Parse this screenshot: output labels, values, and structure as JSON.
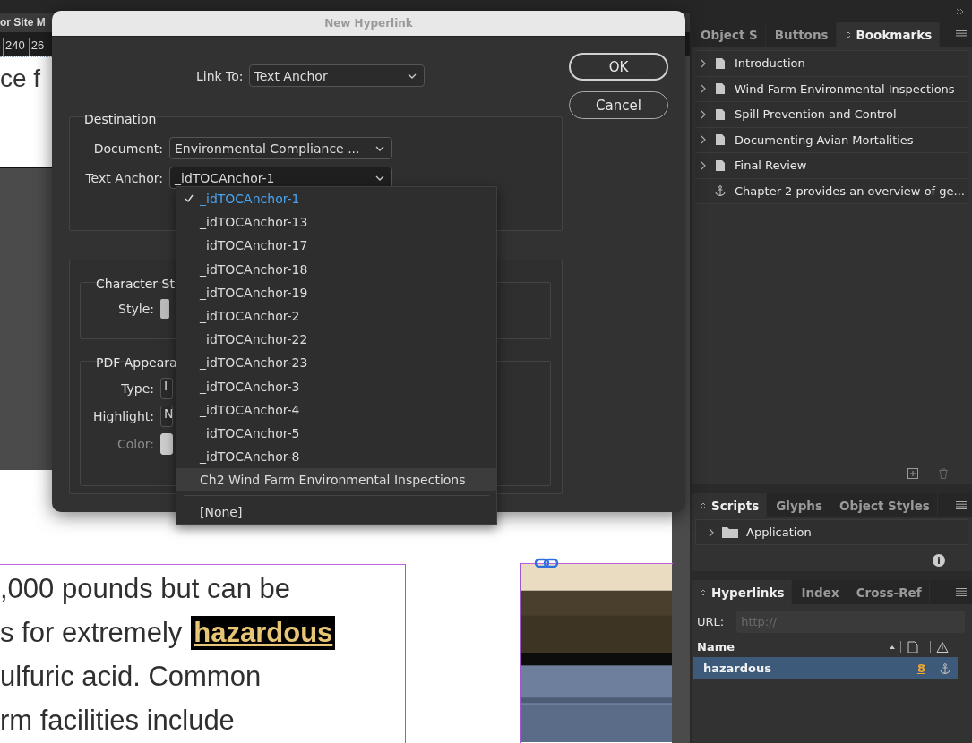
{
  "document": {
    "tab_title": "or Site M",
    "ruler": [
      "240",
      "26"
    ],
    "top_text": "ce f",
    "lines": [
      {
        "text": ",000 pounds but can be"
      },
      {
        "text": "s for extremely",
        "link": "hazardous"
      },
      {
        "text": "ulfuric acid. Common"
      },
      {
        "text": "rm facilities include"
      }
    ],
    "image": {
      "kind": "picture"
    }
  },
  "dialog": {
    "title": "New Hyperlink",
    "link_to": {
      "label": "Link To:",
      "value": "Text Anchor"
    },
    "destination": {
      "title": "Destination",
      "document": {
        "label": "Document:",
        "value": "Environmental Compliance ..."
      },
      "text_anchor": {
        "label": "Text Anchor:",
        "value": "_idTOCAnchor-1"
      }
    },
    "character_style": {
      "title": "Character St",
      "style_label": "Style:"
    },
    "pdf_appearance": {
      "title": "PDF Appeara",
      "fields": [
        {
          "label": "Type:",
          "value": "I",
          "disabled": false
        },
        {
          "label": "Highlight:",
          "value": "N",
          "disabled": false
        },
        {
          "label": "Color:",
          "disabled": true
        }
      ]
    },
    "buttons": [
      {
        "label": "OK",
        "default": true
      },
      {
        "label": "Cancel",
        "default": false
      }
    ]
  },
  "anchor_menu": {
    "items": [
      {
        "label": "_idTOCAnchor-1",
        "selected": true,
        "highlighted": false
      },
      {
        "label": "_idTOCAnchor-13",
        "selected": false,
        "highlighted": false
      },
      {
        "label": "_idTOCAnchor-17",
        "selected": false,
        "highlighted": false
      },
      {
        "label": "_idTOCAnchor-18",
        "selected": false,
        "highlighted": false
      },
      {
        "label": "_idTOCAnchor-19",
        "selected": false,
        "highlighted": false
      },
      {
        "label": "_idTOCAnchor-2",
        "selected": false,
        "highlighted": false
      },
      {
        "label": "_idTOCAnchor-22",
        "selected": false,
        "highlighted": false
      },
      {
        "label": "_idTOCAnchor-23",
        "selected": false,
        "highlighted": false
      },
      {
        "label": "_idTOCAnchor-3",
        "selected": false,
        "highlighted": false
      },
      {
        "label": "_idTOCAnchor-4",
        "selected": false,
        "highlighted": false
      },
      {
        "label": "_idTOCAnchor-5",
        "selected": false,
        "highlighted": false
      },
      {
        "label": "_idTOCAnchor-8",
        "selected": false,
        "highlighted": false
      },
      {
        "label": "Ch2 Wind Farm Environmental Inspections",
        "selected": false,
        "highlighted": true
      }
    ],
    "none_item": "[None]"
  },
  "bookmarks_panel": {
    "tabs": [
      {
        "label": "Object S",
        "selected": false
      },
      {
        "label": "Buttons",
        "selected": false
      },
      {
        "label": "Bookmarks",
        "selected": true
      }
    ],
    "items": [
      {
        "label": "Introduction",
        "kind": "page"
      },
      {
        "label": "Wind Farm Environmental Inspections",
        "kind": "page"
      },
      {
        "label": "Spill Prevention and Control",
        "kind": "page"
      },
      {
        "label": "Documenting Avian Mortalities",
        "kind": "page"
      },
      {
        "label": "Final Review",
        "kind": "page"
      },
      {
        "label": "Chapter 2 provides an overview of ge...",
        "kind": "anchor"
      }
    ]
  },
  "scripts_panel": {
    "tabs": [
      {
        "label": "Scripts",
        "selected": true
      },
      {
        "label": "Glyphs",
        "selected": false
      },
      {
        "label": "Object Styles",
        "selected": false
      }
    ],
    "items": [
      {
        "label": "Application"
      }
    ]
  },
  "hyperlinks_panel": {
    "tabs": [
      {
        "label": "Hyperlinks",
        "selected": true
      },
      {
        "label": "Index",
        "selected": false
      },
      {
        "label": "Cross-Ref",
        "selected": false
      }
    ],
    "url": {
      "label": "URL:",
      "placeholder": "http://"
    },
    "column": "Name",
    "rows": [
      {
        "name": "hazardous",
        "page": "8",
        "selected": true
      }
    ]
  }
}
